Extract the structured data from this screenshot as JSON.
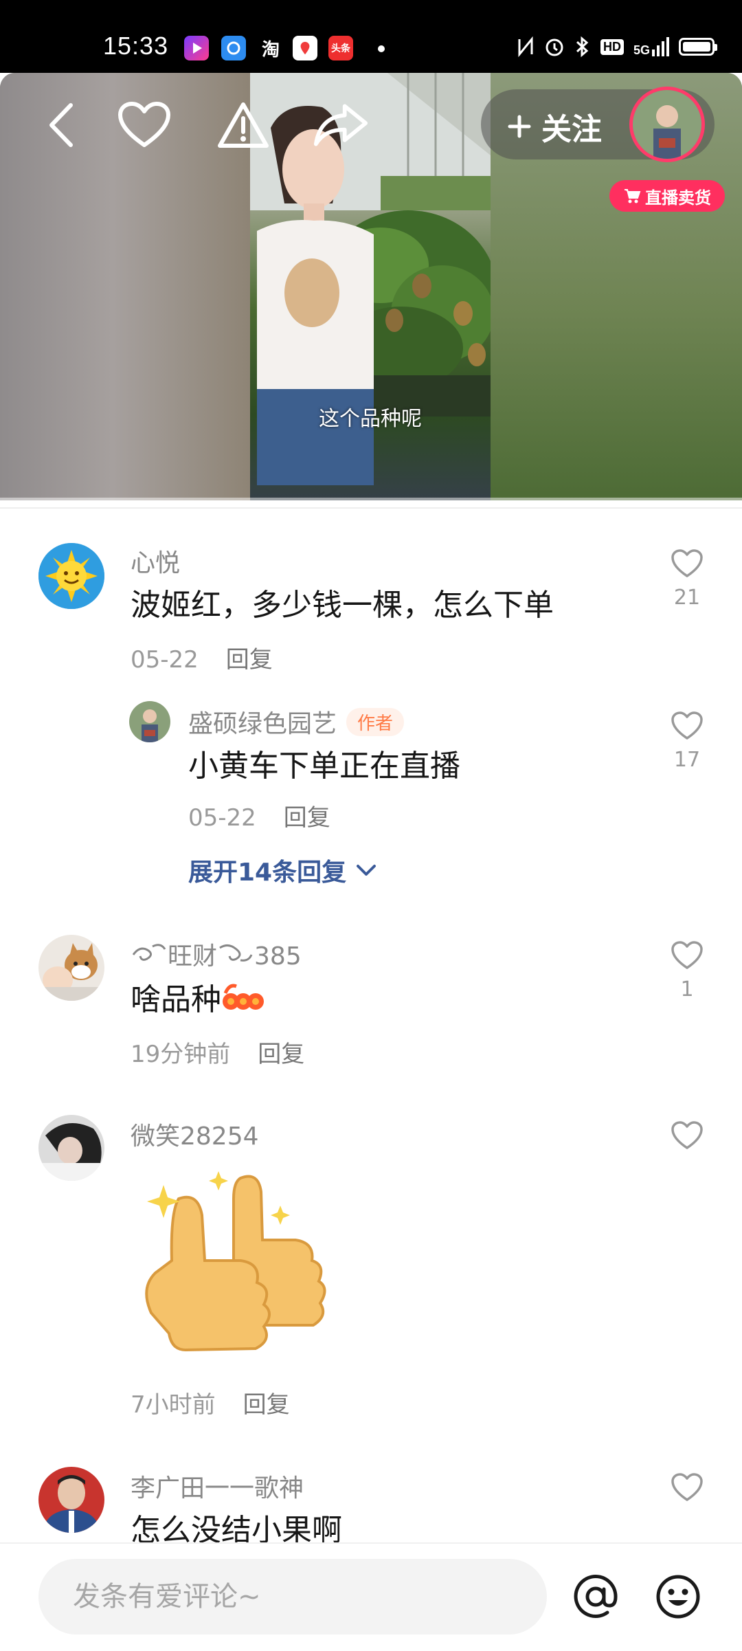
{
  "status_bar": {
    "time": "15:33",
    "app_icons": [
      "video-app-icon",
      "browser-app-icon",
      "taobao-app-icon",
      "map-app-icon",
      "toutiao-app-icon"
    ],
    "taobao_label": "淘",
    "toutiao_label": "头条",
    "indicators": [
      "nfc-icon",
      "alarm-icon",
      "bluetooth-icon",
      "hd-icon",
      "5g-signal-icon",
      "battery-icon"
    ],
    "hd_label": "HD",
    "network_label": "5G"
  },
  "video": {
    "subtitle": "这个品种呢",
    "follow_label": "关注",
    "live_badge": "直播卖货"
  },
  "comments": [
    {
      "user": "心悦",
      "text": "波姬红，多少钱一棵，怎么下单",
      "time": "05-22",
      "reply_label": "回复",
      "likes": "21"
    },
    {
      "user": "盛硕绿色园艺",
      "author_tag": "作者",
      "text": "小黄车下单正在直播",
      "time": "05-22",
      "reply_label": "回复",
      "likes": "17"
    },
    {
      "user": "旺财",
      "user_suffix": "385",
      "text": "啥品种",
      "time": "19分钟前",
      "reply_label": "回复",
      "likes": "1"
    },
    {
      "user": "微笑28254",
      "text": "",
      "time": "7小时前",
      "reply_label": "回复",
      "likes": ""
    },
    {
      "user": "李广田一一歌神",
      "text": "怎么没结小果啊",
      "likes": ""
    }
  ],
  "expand_replies": "展开14条回复",
  "input": {
    "placeholder": "发条有爱评论~"
  },
  "colors": {
    "accent_pink": "#ff2f5f",
    "author_tag": "#ff7a45",
    "expand_link": "#3a5a99"
  }
}
